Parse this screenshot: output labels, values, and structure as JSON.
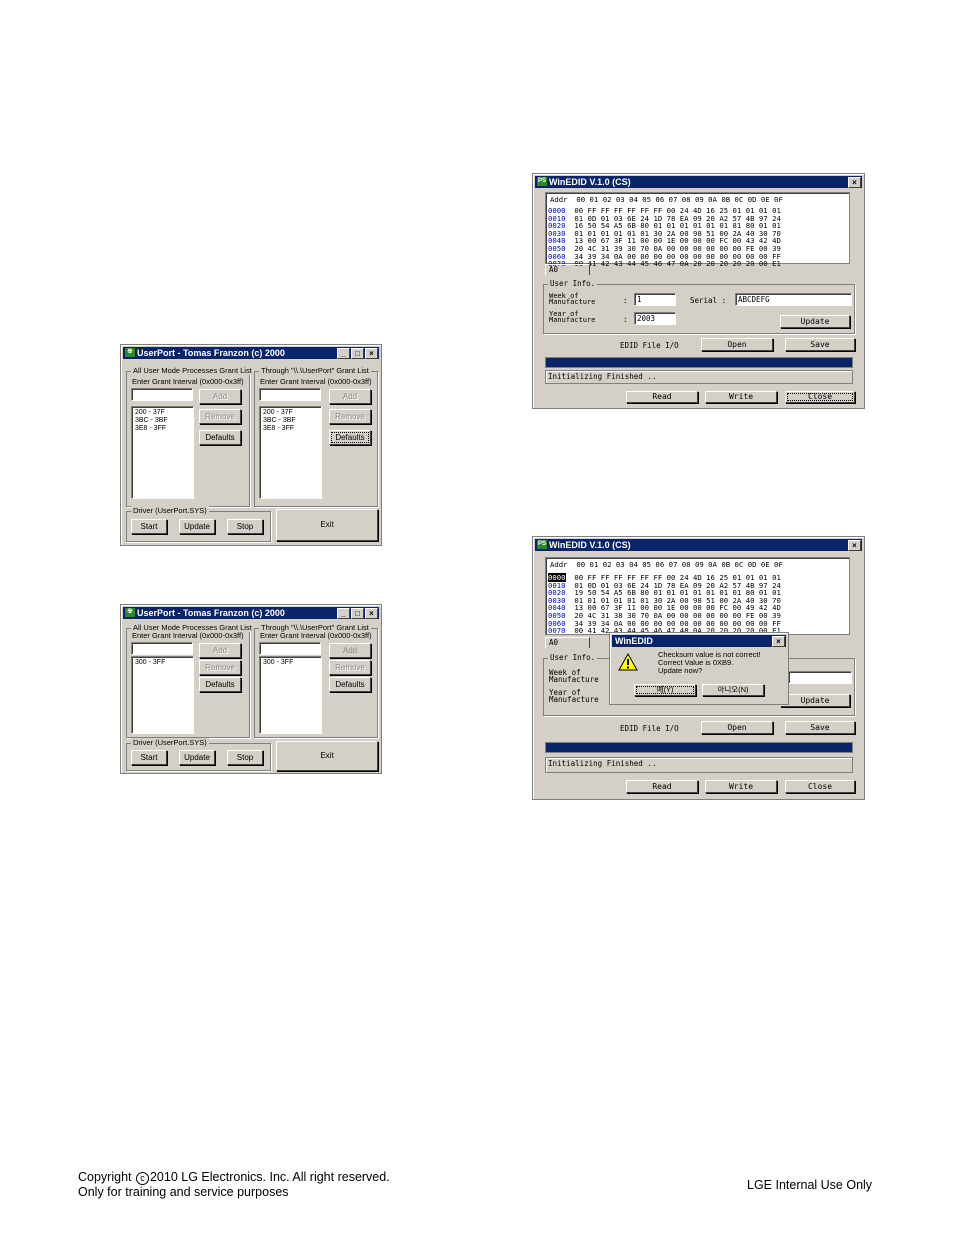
{
  "userport": {
    "title": "UserPort - Tomas Franzon (c) 2000",
    "title_buttons": [
      "_",
      "□",
      "×"
    ],
    "left_group_label": "All User Mode Processes Grant List",
    "right_group_label": "Through \"\\\\.\\UserPort\" Grant List",
    "interval_label": "Enter Grant Interval (0x000-0x3ff)",
    "add": "Add",
    "remove": "Remove",
    "defaults": "Defaults",
    "driver_label": "Driver (UserPort.SYS)",
    "start": "Start",
    "update": "Update",
    "stop": "Stop",
    "exit": "Exit",
    "window1_left_list": [
      "200 - 37F",
      "3BC - 3BF",
      "3E8 - 3FF"
    ],
    "window1_right_list": [
      "200 - 37F",
      "3BC - 3BF",
      "3E8 - 3FF"
    ],
    "window2_left_list": [
      "300 - 3FF"
    ],
    "window2_right_list": [
      "300 - 3FF"
    ]
  },
  "winedid": {
    "title": "WinEDID V.1.0 (CS)",
    "close_x": "×",
    "header": "Addr  00 01 02 03 04 05 06 07 08 09 0A 0B 0C 0D 0E 0F",
    "rows1": [
      {
        "addr": "0000",
        "bytes": "00 FF FF FF FF FF FF 00 24 4D 16 25 01 01 01 01"
      },
      {
        "addr": "0010",
        "bytes": "01 0D 01 03 6E 24 1D 78 EA 09 20 A2 57 4B 97 24"
      },
      {
        "addr": "0020",
        "bytes": "16 50 54 A5 6B 80 01 01 01 01 01 01 81 80 01 01"
      },
      {
        "addr": "0030",
        "bytes": "01 01 01 01 01 01 30 2A 00 98 51 00 2A 40 30 70"
      },
      {
        "addr": "0040",
        "bytes": "13 00 67 3F 11 00 00 1E 00 00 00 FC 00 43 42 4D"
      },
      {
        "addr": "0050",
        "bytes": "20 4C 31 39 30 70 0A 00 00 00 00 00 00 FE 00 39"
      },
      {
        "addr": "0060",
        "bytes": "34 39 34 0A 00 00 00 00 00 00 00 00 00 00 00 FF"
      },
      {
        "addr": "0070",
        "bytes": "00 41 42 43 44 45 46 47 0A 20 20 20 20 20 00 E1"
      }
    ],
    "rows2": [
      {
        "addr": "0000",
        "bytes": "00 FF FF FF FF FF FF 00 24 4D 16 25 01 01 01 01"
      },
      {
        "addr": "0010",
        "bytes": "01 0D 01 03 6E 24 1D 78 EA 09 20 A2 57 4B 97 24"
      },
      {
        "addr": "0020",
        "bytes": "19 50 54 A5 6B 80 01 01 01 01 01 01 01 80 01 01"
      },
      {
        "addr": "0030",
        "bytes": "01 01 01 01 01 01 30 2A 00 98 51 00 2A 40 30 70"
      },
      {
        "addr": "0040",
        "bytes": "13 00 67 3F 11 00 00 1E 00 00 00 FC 00 49 42 4D"
      },
      {
        "addr": "0050",
        "bytes": "20 4C 31 38 30 70 0A 00 00 00 00 00 00 FE 00 39"
      },
      {
        "addr": "0060",
        "bytes": "34 39 34 0A 00 00 00 00 00 00 00 00 00 00 00 FF"
      },
      {
        "addr": "0070",
        "bytes": "00 41 42 43 44 45 46 47 48 0A 20 20 20 20 00 E1"
      }
    ],
    "tab": "A0",
    "user_info_label": "User Info.",
    "week_label_1": "Week of",
    "week_label_2": "Manufacture",
    "year_label_1": "Year of",
    "year_label_2": "Manufacture",
    "colon": ":",
    "week_value": "1",
    "serial_label": "Serial :",
    "serial_value": "ABCDEFG",
    "year_value": "2003",
    "update": "Update",
    "file_io_label": "EDID File I/O",
    "open": "Open",
    "save": "Save",
    "status": "Initializing Finished ..",
    "read": "Read",
    "write": "Write",
    "close": "Close"
  },
  "dialog": {
    "title": "WinEDID",
    "close_x": "×",
    "icon": "warning-icon",
    "message_1": "Checksum value is not correct!",
    "message_2": "Correct Value is 0XB9.",
    "message_3": "Update now?",
    "yes": "예(Y)",
    "no": "아니오(N)"
  },
  "footer": {
    "copyright_prefix": "Copyright",
    "copyright_symbol": "c",
    "copyright_text": "2010 LG Electronics. Inc. All right reserved.",
    "line2": "Only for training and service purposes",
    "right": "LGE Internal Use Only"
  }
}
